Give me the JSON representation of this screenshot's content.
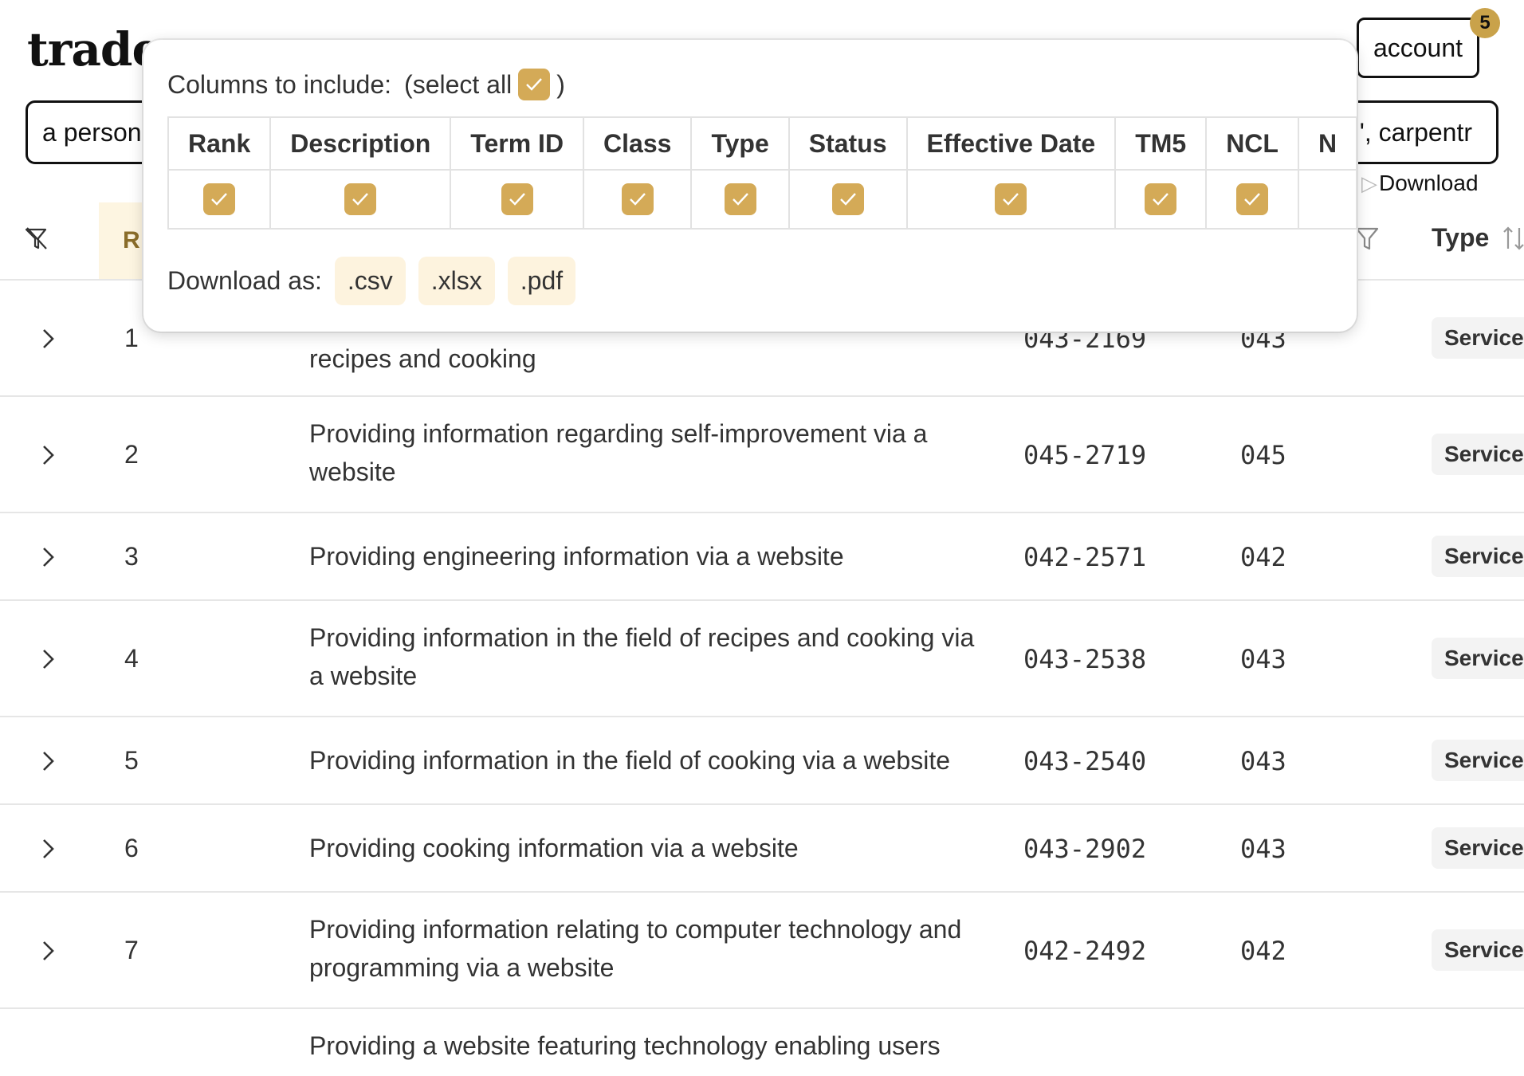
{
  "header": {
    "logo_text": "trader",
    "account_label": "account",
    "notification_count": "5"
  },
  "search": {
    "left_text": "a person",
    "right_text": "', carpentr"
  },
  "download_label": "Download",
  "table": {
    "rank_header": "R",
    "type_header": "Type",
    "rows": [
      {
        "rank": "1",
        "description": "recipes and cooking",
        "term_id": "043-2169",
        "class": "043",
        "type": "Service"
      },
      {
        "rank": "2",
        "description": "Providing information regarding self-improvement via a website",
        "term_id": "045-2719",
        "class": "045",
        "type": "Service"
      },
      {
        "rank": "3",
        "description": "Providing engineering information via a website",
        "term_id": "042-2571",
        "class": "042",
        "type": "Service"
      },
      {
        "rank": "4",
        "description": "Providing information in the field of recipes and cooking via a website",
        "term_id": "043-2538",
        "class": "043",
        "type": "Service"
      },
      {
        "rank": "5",
        "description": "Providing information in the field of cooking via a website",
        "term_id": "043-2540",
        "class": "043",
        "type": "Service"
      },
      {
        "rank": "6",
        "description": "Providing cooking information via a website",
        "term_id": "043-2902",
        "class": "043",
        "type": "Service"
      },
      {
        "rank": "7",
        "description": "Providing information relating to computer technology and programming via a website",
        "term_id": "042-2492",
        "class": "042",
        "type": "Service"
      },
      {
        "rank": "",
        "description": "Providing a website featuring technology enabling users",
        "term_id": "",
        "class": "",
        "type": ""
      }
    ]
  },
  "popover": {
    "columns_label": "Columns to include:",
    "select_all_prefix": "(select all",
    "select_all_suffix": ")",
    "columns": [
      "Rank",
      "Description",
      "Term ID",
      "Class",
      "Type",
      "Status",
      "Effective Date",
      "TM5",
      "NCL",
      "N"
    ],
    "download_as_label": "Download as:",
    "formats": [
      ".csv",
      ".xlsx",
      ".pdf"
    ]
  },
  "colors": {
    "accent": "#d4aa57",
    "badge": "#c9a24a",
    "rank_header_bg": "#fdf5e1",
    "format_button_bg": "#fdf3de"
  }
}
